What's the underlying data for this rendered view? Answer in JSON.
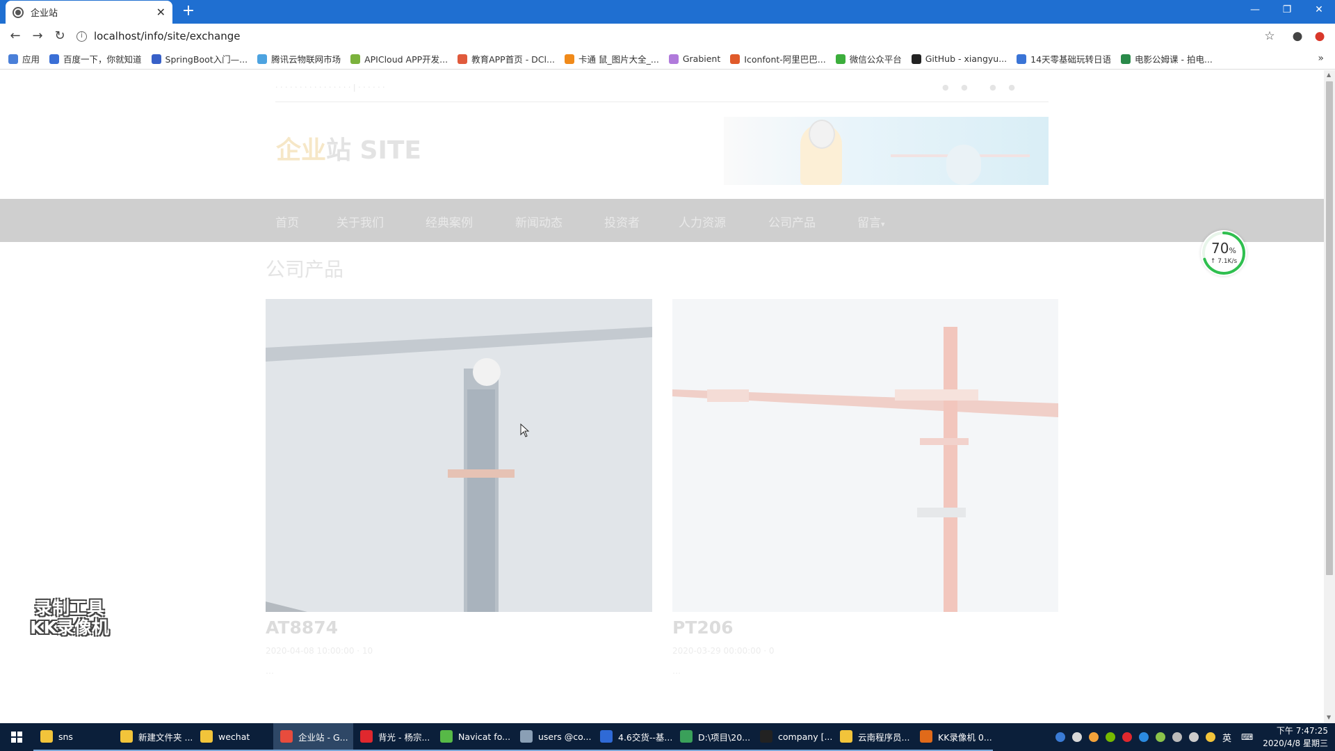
{
  "browser": {
    "tab_title": "企业站",
    "url": "localhost/info/site/exchange",
    "bookmarks": [
      "应用",
      "百度一下，你就知道",
      "SpringBoot入门—...",
      "腾讯云物联网市场",
      "APICloud APP开发...",
      "教育APP首页 - DCl...",
      "卡通 鼠_图片大全_...",
      "Grabient",
      "Iconfont-阿里巴巴...",
      "微信公众平台",
      "GitHub - xiangyu...",
      "14天零基础玩转日语",
      "电影公姆课 - 拍电..."
    ],
    "bookmark_colors": [
      "#4a7fd8",
      "#3a6fd6",
      "#3760c8",
      "#4da3e0",
      "#7bb23c",
      "#e05a3c",
      "#f08a1a",
      "#b07adb",
      "#e05a2a",
      "#3cae3c",
      "#222222",
      "#3a74d6",
      "#2a8a4a"
    ]
  },
  "site": {
    "logo_part1": "企业",
    "logo_part2": "站 SITE",
    "nav": [
      "首页",
      "关于我们",
      "经典案例",
      "新闻动态",
      "投资者",
      "人力资源",
      "公司产品",
      "留言"
    ],
    "nav_dropdown_caret": "▾",
    "section_title": "公司产品",
    "products": [
      {
        "name": "AT8874",
        "meta": "2020-04-08 10:00:00 · 10",
        "desc": "…"
      },
      {
        "name": "PT206",
        "meta": "2020-03-29 00:00:00 · 0",
        "desc": "…"
      }
    ]
  },
  "speed_widget": {
    "percent": "70",
    "percent_unit": "%",
    "rate": "↑ 7.1K/s",
    "fraction": 0.7
  },
  "watermark": {
    "line1": "录制工具",
    "line2": "KK录像机"
  },
  "taskbar": {
    "items": [
      "sns",
      "新建文件夹 ...",
      "wechat",
      "企业站 - G...",
      "背光 - 杨宗...",
      "Navicat fo...",
      "users @co...",
      "4.6交货--基...",
      "D:\\项目\\20...",
      "company [...",
      "云南程序员...",
      "KK录像机 0..."
    ],
    "item_colors": [
      "#f2c43a",
      "#f2c43a",
      "#f2c43a",
      "#e84c3d",
      "#e0282e",
      "#57b947",
      "#8a9fb5",
      "#2f6ad6",
      "#3aa05a",
      "#222222",
      "#f2c43a",
      "#e06a1a"
    ],
    "active_index": 3,
    "ime": "英",
    "time": "下午 7:47:25",
    "date": "2020/4/8 星期三"
  }
}
